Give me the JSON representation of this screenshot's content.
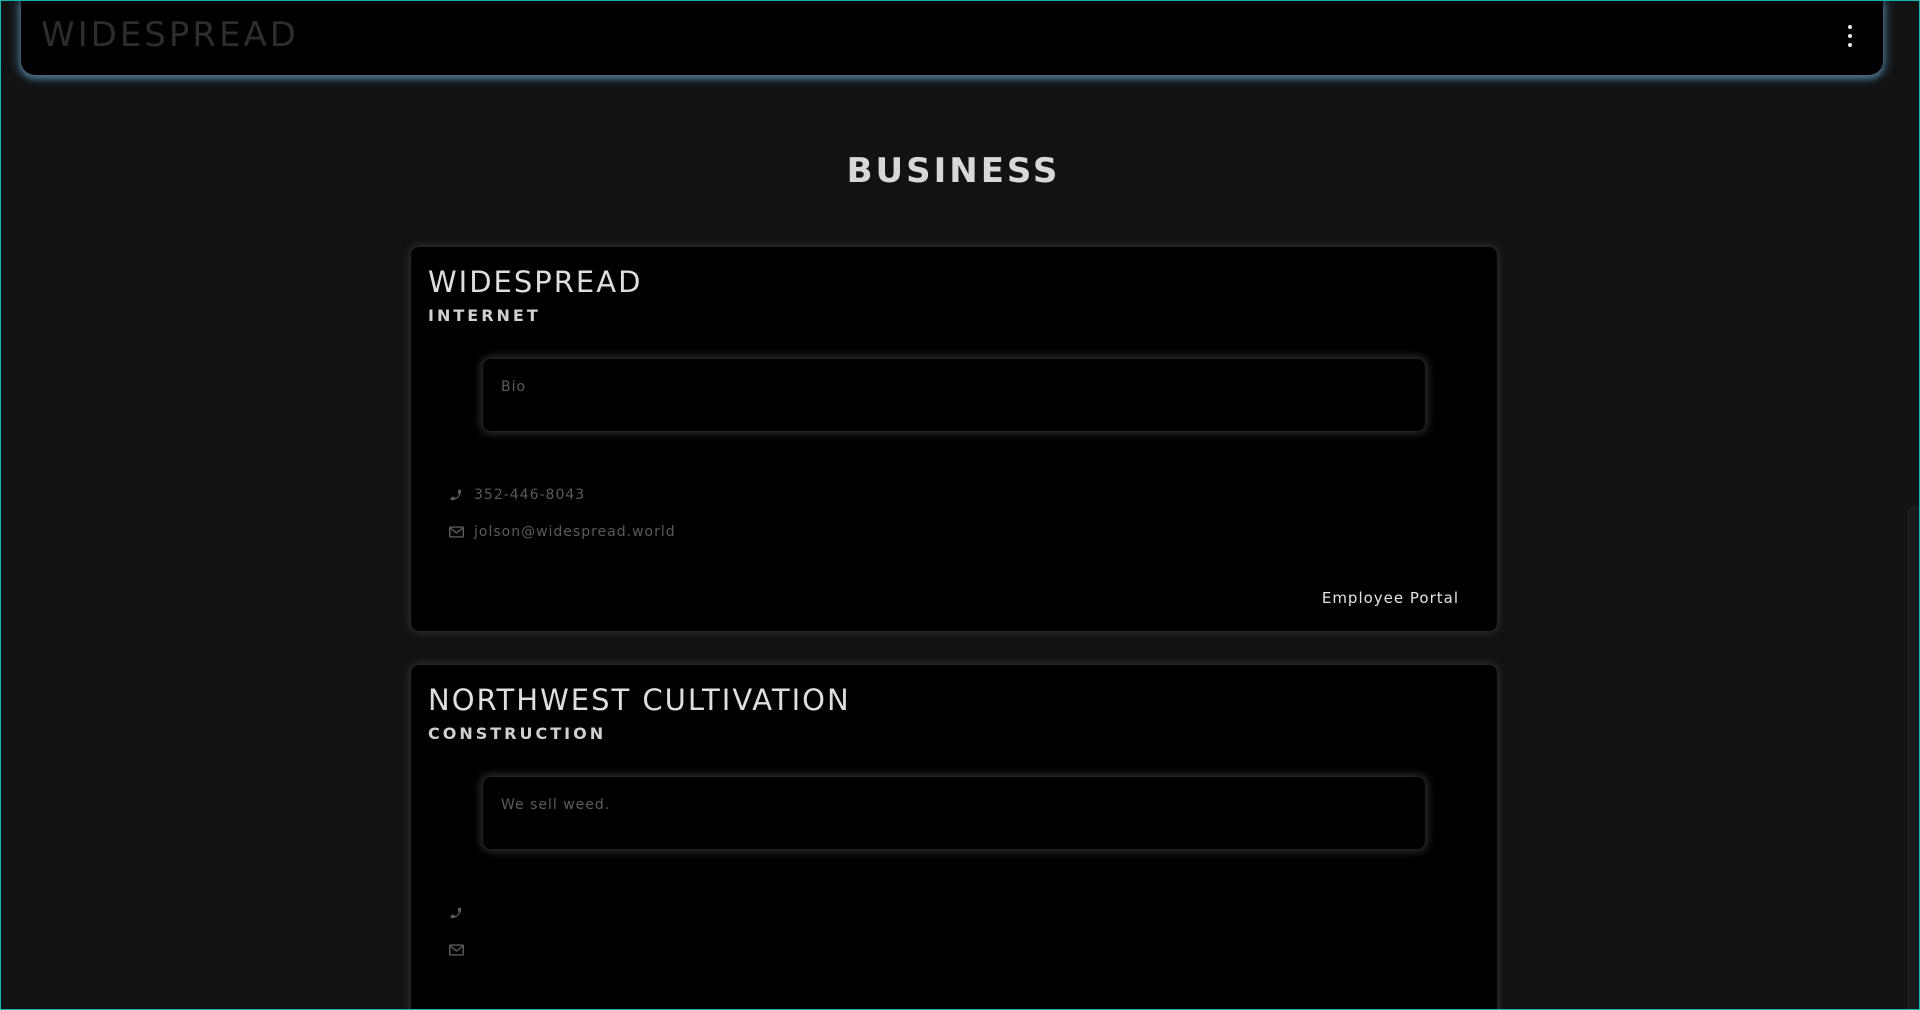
{
  "navbar": {
    "brand": "WIDESPREAD",
    "menu_icon": "kebab-vertical-icon"
  },
  "page": {
    "title": "BUSINESS"
  },
  "businesses": [
    {
      "name": "WIDESPREAD",
      "category": "INTERNET",
      "bio": "Bio",
      "phone": "352-446-8043",
      "email": "jolson@widespread.world",
      "portal_label": "Employee Portal"
    },
    {
      "name": "NORTHWEST CULTIVATION",
      "category": "CONSTRUCTION",
      "bio": "We sell weed.",
      "phone": "",
      "email": ""
    }
  ],
  "icons": {
    "phone": "phone-icon",
    "email": "envelope-icon"
  },
  "colors": {
    "background": "#121212",
    "card": "#000000",
    "nav_glow": "#5fa0cd",
    "frame_border": "#17b3b3"
  }
}
